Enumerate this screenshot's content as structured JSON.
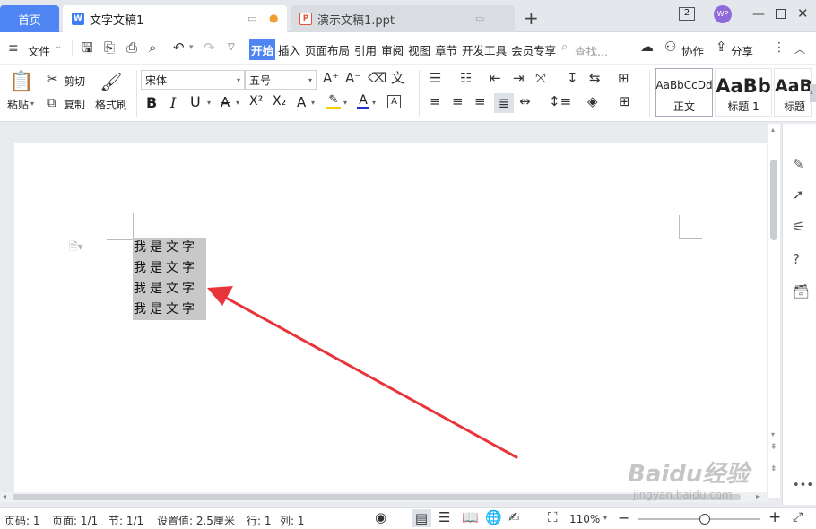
{
  "tabs": {
    "home": "首页",
    "doc": "文字文稿1",
    "ppt": "演示文稿1.ppt",
    "badge": "2",
    "avatar": "WP"
  },
  "menu": {
    "file": "文件",
    "items": [
      "开始",
      "插入",
      "页面布局",
      "引用",
      "审阅",
      "视图",
      "章节",
      "开发工具",
      "会员专享"
    ],
    "search_placeholder": "查找...",
    "collab": "协作",
    "share": "分享"
  },
  "ribbon": {
    "paste": "粘贴",
    "cut": "剪切",
    "copy": "复制",
    "format_painter": "格式刷",
    "font_name": "宋体",
    "font_size": "五号",
    "styles": [
      {
        "preview": "AaBbCcDd",
        "name": "正文"
      },
      {
        "preview": "AaBb",
        "name": "标题 1"
      },
      {
        "preview": "AaBl",
        "name": "标题"
      }
    ]
  },
  "document": {
    "lines": [
      "我是文字",
      "我是文字",
      "我是文字",
      "我是文字"
    ]
  },
  "annotation": {
    "arrow_color": "#e8353b"
  },
  "status": {
    "page": "页码: 1",
    "pages": "页面: 1/1",
    "section": "节: 1/1",
    "setting": "设置值: 2.5厘米",
    "row": "行: 1",
    "col": "列: 1",
    "zoom": "110%"
  },
  "zoom_level": 0.55,
  "watermark": {
    "text": "Baidu经验",
    "url": "jingyan.baidu.com"
  },
  "colors": {
    "accent": "#4f84f3",
    "highlight": "#f5d000",
    "font_color": "#2233cc"
  }
}
